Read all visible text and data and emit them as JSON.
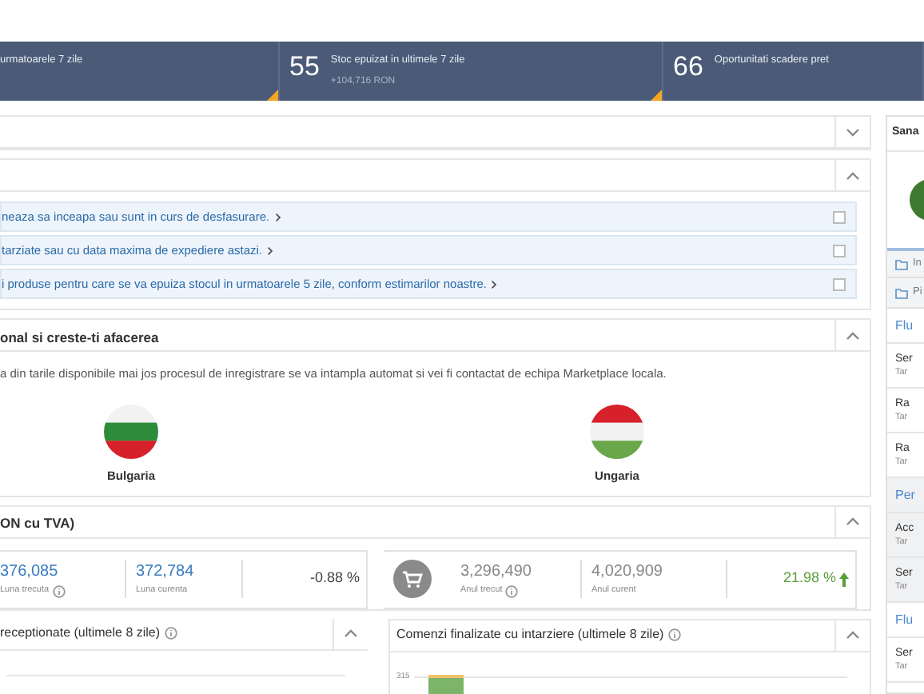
{
  "stats_band": [
    {
      "label": "urmatoarele 7 zile",
      "alert": true
    },
    {
      "number": "55",
      "label": "Stoc epuizat in ultimele 7 zile",
      "sub": "+104,716 RON",
      "alert": true
    },
    {
      "number": "66",
      "label": "Oportunitati scadere pret",
      "alert": false
    }
  ],
  "panels": [
    {
      "expanded": false
    },
    {
      "kind": "alerts",
      "expanded": true,
      "items": [
        {
          "text": "neaza sa inceapa sau sunt in curs de desfasurare.",
          "checked": false
        },
        {
          "text": "tarziate sau cu data maxima de expediere astazi.",
          "checked": false
        },
        {
          "text": "i produse pentru care se va epuiza stocul in urmatoarele 5 zile, conform estimarilor noastre.",
          "checked": false
        }
      ]
    },
    {
      "kind": "countries",
      "expanded": true,
      "title": "onal si creste-ti afacerea",
      "text": "a din tarile disponibile mai jos procesul de inregistrare se va intampla automat si vei fi contactat de echipa Marketplace locala.",
      "countries": [
        {
          "name": "Bulgaria",
          "kind": "bulgaria"
        },
        {
          "name": "Ungaria",
          "kind": "hungary"
        }
      ]
    },
    {
      "kind": "sales",
      "expanded": true,
      "title": "ON cu TVA)",
      "cards": [
        {
          "icon": false,
          "previous": "376,085",
          "previous_label": "Luna trecuta",
          "current": "372,784",
          "current_label": "Luna curenta",
          "change": "-0.88 %",
          "rising": false
        },
        {
          "icon": true,
          "previous": "3,296,490",
          "previous_label": "Anul trecut",
          "current": "4,020,909",
          "current_label": "Anul curent",
          "change": "21.98 %",
          "rising": true
        }
      ]
    }
  ],
  "chart_panels": [
    {
      "title": "receptionate (ultimele 8 zile)",
      "expanded": true
    },
    {
      "title": "Comenzi finalizate cu intarziere (ultimele 8 zile)",
      "expanded": true,
      "tick": "315"
    }
  ],
  "sidebar": {
    "title": "Sana",
    "folders": [
      {
        "label": "In"
      },
      {
        "label": "Pi"
      }
    ],
    "sections": [
      {
        "heading": "Flu",
        "shaded": false,
        "items": [
          {
            "title": "Ser",
            "subtitle": "Tar"
          },
          {
            "title": "Ra",
            "subtitle": "Tar"
          },
          {
            "title": "Ra",
            "subtitle": "Tar"
          }
        ]
      },
      {
        "heading": "Per",
        "shaded": true,
        "items": [
          {
            "title": "Acc",
            "subtitle": "Tar"
          },
          {
            "title": "Ser",
            "subtitle": "Tar"
          }
        ]
      },
      {
        "heading": "Flu",
        "shaded": false,
        "items": [
          {
            "title": "Ser",
            "subtitle": "Tar"
          }
        ]
      }
    ]
  }
}
